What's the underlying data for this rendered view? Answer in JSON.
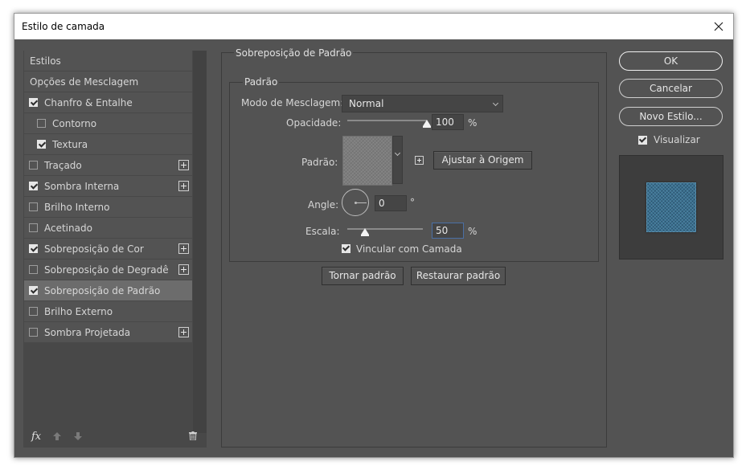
{
  "window": {
    "title": "Estilo de camada"
  },
  "colors": {
    "panel_bg": "#535353",
    "selected_bg": "#6c6c6c",
    "text": "#d6d6d6",
    "preview_pattern": "#3b6f8e"
  },
  "style_list": {
    "items": [
      {
        "label": "Estilos",
        "checkbox": false,
        "checked": false,
        "plus": false,
        "selected": false
      },
      {
        "label": "Opções de Mesclagem",
        "checkbox": false,
        "checked": false,
        "plus": false,
        "selected": false
      },
      {
        "label": "Chanfro & Entalhe",
        "checkbox": true,
        "checked": true,
        "plus": false,
        "selected": false
      },
      {
        "label": "Contorno",
        "checkbox": true,
        "checked": false,
        "plus": false,
        "selected": false,
        "sub": true
      },
      {
        "label": "Textura",
        "checkbox": true,
        "checked": true,
        "plus": false,
        "selected": false,
        "sub": true
      },
      {
        "label": "Traçado",
        "checkbox": true,
        "checked": false,
        "plus": true,
        "selected": false
      },
      {
        "label": "Sombra Interna",
        "checkbox": true,
        "checked": true,
        "plus": true,
        "selected": false
      },
      {
        "label": "Brilho Interno",
        "checkbox": true,
        "checked": false,
        "plus": false,
        "selected": false
      },
      {
        "label": "Acetinado",
        "checkbox": true,
        "checked": false,
        "plus": false,
        "selected": false
      },
      {
        "label": "Sobreposição de Cor",
        "checkbox": true,
        "checked": true,
        "plus": true,
        "selected": false
      },
      {
        "label": "Sobreposição de Degradê",
        "checkbox": true,
        "checked": false,
        "plus": true,
        "selected": false
      },
      {
        "label": "Sobreposição de Padrão",
        "checkbox": true,
        "checked": true,
        "plus": false,
        "selected": true
      },
      {
        "label": "Brilho Externo",
        "checkbox": true,
        "checked": false,
        "plus": false,
        "selected": false
      },
      {
        "label": "Sombra Projetada",
        "checkbox": true,
        "checked": false,
        "plus": true,
        "selected": false
      }
    ],
    "footer": {
      "fx_label": "fx"
    }
  },
  "pattern_overlay": {
    "section_title": "Sobreposição de Padrão",
    "group_title": "Padrão",
    "blend_mode_label": "Modo de Mesclagem:",
    "blend_mode_value": "Normal",
    "opacity_label": "Opacidade:",
    "opacity_value": "100",
    "opacity_level": 1.0,
    "opacity_unit": "%",
    "pattern_label": "Padrão:",
    "snap_origin_button": "Ajustar à Origem",
    "angle_label": "Angle:",
    "angle_value": "0",
    "angle_unit": "°",
    "scale_label": "Escala:",
    "scale_value": "50",
    "scale_unit": "%",
    "link_layer_label": "Vincular com Camada",
    "link_layer_checked": true,
    "make_default_button": "Tornar padrão",
    "reset_default_button": "Restaurar padrão"
  },
  "actions": {
    "ok": "OK",
    "cancel": "Cancelar",
    "new_style": "Novo Estilo...",
    "preview_label": "Visualizar",
    "preview_checked": true
  }
}
